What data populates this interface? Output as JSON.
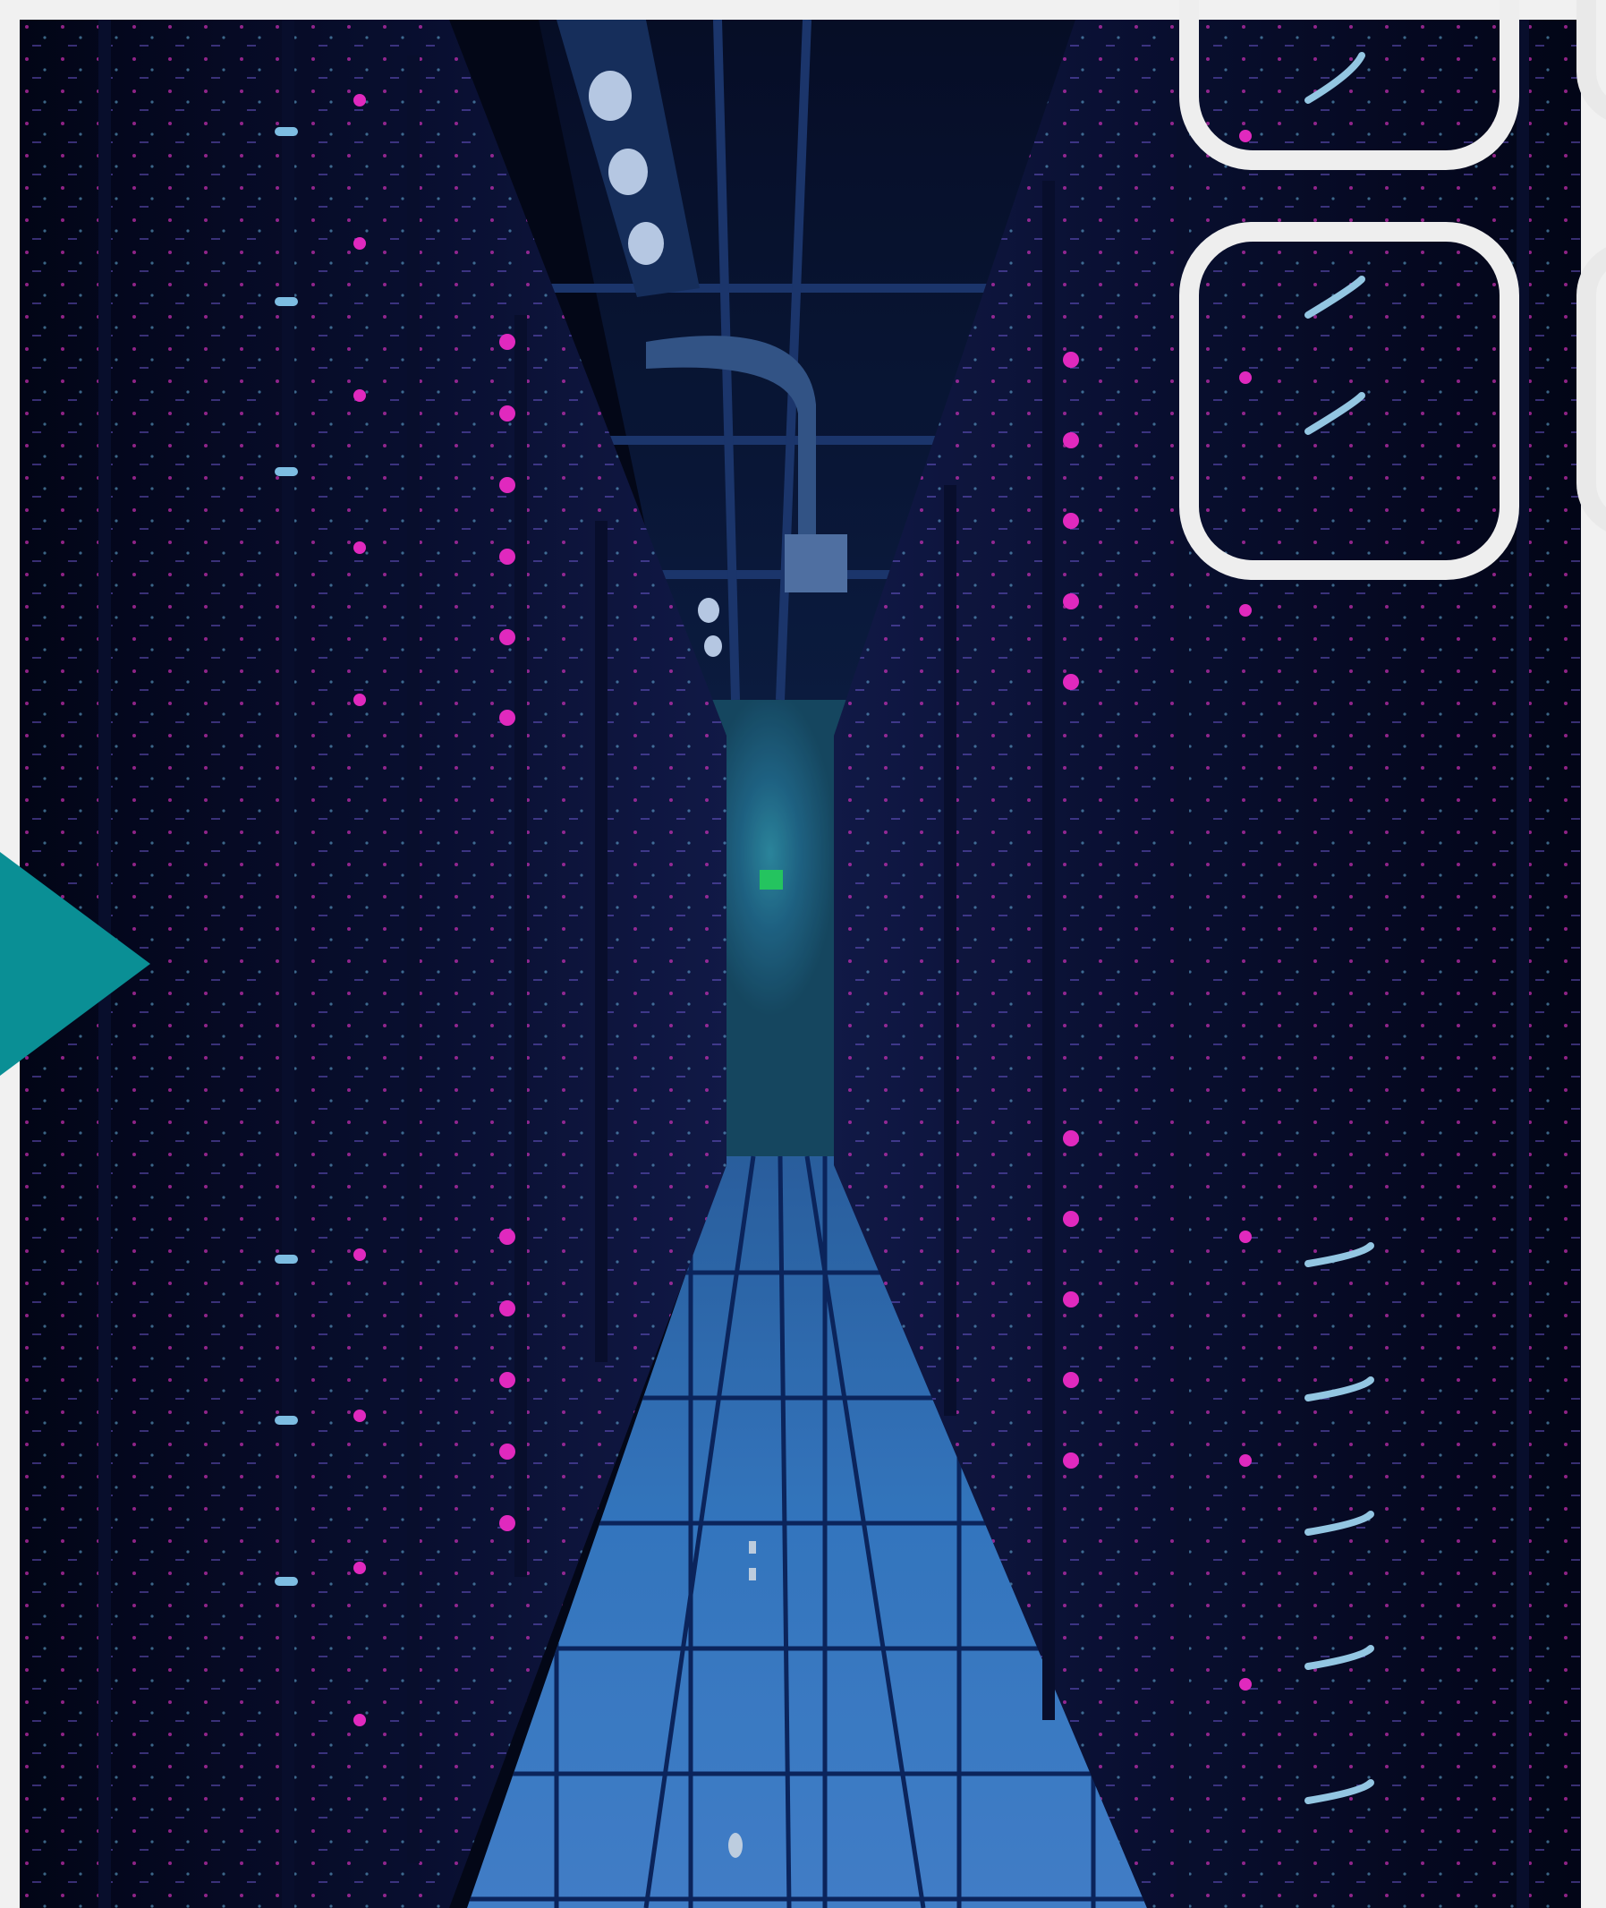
{
  "viewer": {
    "photo_icon": "server-room-photo",
    "next_icon": "play-arrow-icon",
    "accent_color": "#0a8f95",
    "thumbnail_count": 2
  }
}
